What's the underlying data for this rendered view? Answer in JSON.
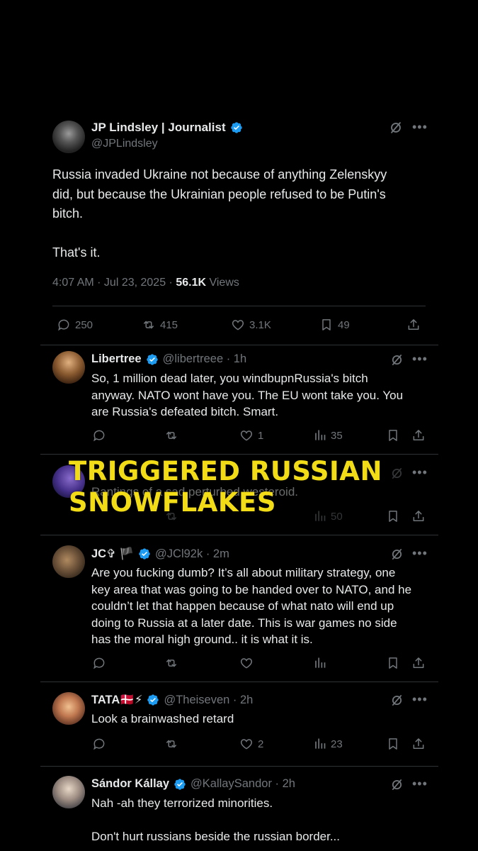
{
  "main_tweet": {
    "author_name": "JP Lindsley | Journalist",
    "author_handle": "@JPLindsley",
    "text_lines": [
      "Russia invaded Ukraine not because of anything Zelenskyy",
      "did, but because the Ukrainian people refused to be Putin's",
      "bitch.",
      "",
      "That's it."
    ],
    "time_date": "4:07 AM · Jul 23, 2025 · ",
    "views_count": "56.1K",
    "views_label": " Views",
    "replies": "250",
    "reposts": "415",
    "likes": "3.1K",
    "bookmarks": "49"
  },
  "replies": [
    {
      "name": "Libertree",
      "handle_time": "@libertreee · 1h",
      "lines": [
        "So, 1 million dead later, you windbupnRussia's bitch",
        "anyway. NATO wont have you. The EU wont take you. You",
        "are Russia's defeated bitch. Smart."
      ],
      "likes": "1",
      "views": "35"
    },
    {
      "name": "",
      "handle_time": "",
      "lines": [
        "Rantings of a sad perturbed westeroid."
      ],
      "likes": "",
      "views": "50"
    },
    {
      "name": "JC✞ 🏴",
      "handle_time": "@JCl92k · 2m",
      "lines": [
        "Are you fucking dumb? It’s all about military strategy, one",
        "key area that was going to be handed over to NATO, and he",
        "couldn’t let that happen because of what nato will end up",
        "doing to Russia at a later date. This is war games no side",
        "has the moral high ground.. it is what it is."
      ],
      "likes": "",
      "views": ""
    },
    {
      "name": "TATA🇩🇰⚡",
      "handle_time": "@Theiseven · 2h",
      "lines": [
        "Look a brainwashed retard"
      ],
      "likes": "2",
      "views": "23"
    },
    {
      "name": "Sándor Kállay",
      "handle_time": "@KallaySandor · 2h",
      "lines": [
        "Nah -ah they terrorized minorities.",
        "",
        "Don't hurt russians beside the russian border..."
      ],
      "likes": "",
      "views": ""
    }
  ],
  "overlay": {
    "line1": "TRIGGERED RUSSIAN",
    "line2": "SNOWFLAKES"
  },
  "icons": [
    "grok-icon",
    "more-icon",
    "reply-icon",
    "repost-icon",
    "like-icon",
    "views-icon",
    "bookmark-icon",
    "share-icon",
    "verified-badge-icon"
  ],
  "colors": {
    "background": "#000000",
    "text": "#e7e9ea",
    "muted": "#71767b",
    "verified": "#1d9bf0",
    "overlay": "#f2dc17",
    "divider": "#2f3336"
  }
}
